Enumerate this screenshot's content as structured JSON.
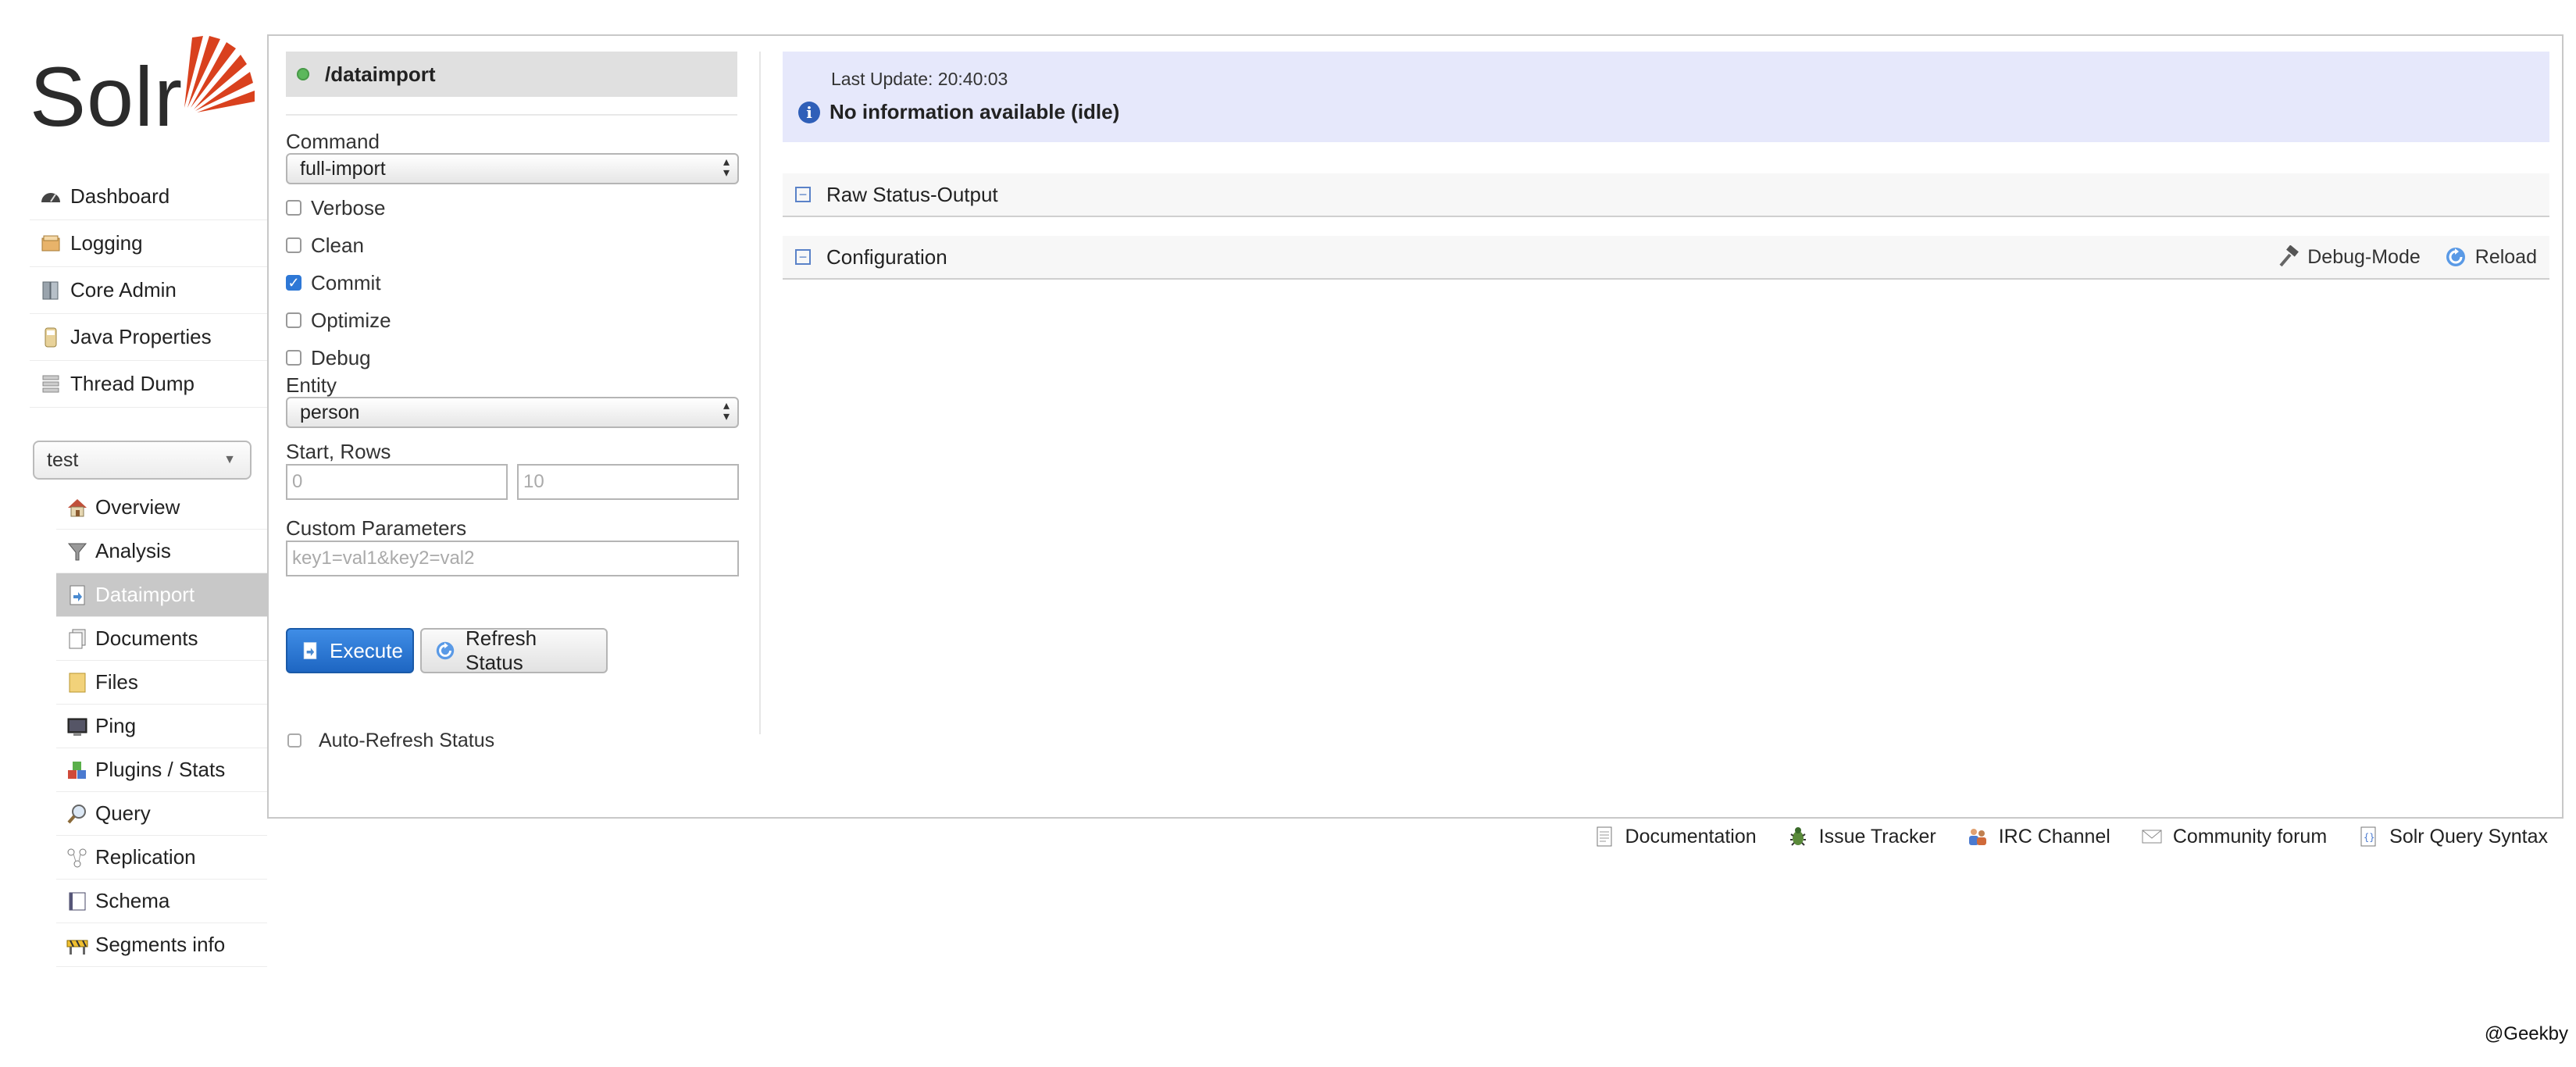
{
  "logo": {
    "text": "Solr"
  },
  "main_menu": [
    {
      "label": "Dashboard",
      "icon": "dashboard-icon"
    },
    {
      "label": "Logging",
      "icon": "logging-icon"
    },
    {
      "label": "Core Admin",
      "icon": "core-admin-icon"
    },
    {
      "label": "Java Properties",
      "icon": "java-properties-icon"
    },
    {
      "label": "Thread Dump",
      "icon": "thread-dump-icon"
    }
  ],
  "core_selector": {
    "value": "test"
  },
  "core_menu": [
    {
      "label": "Overview",
      "icon": "home-icon"
    },
    {
      "label": "Analysis",
      "icon": "funnel-icon"
    },
    {
      "label": "Dataimport",
      "icon": "dataimport-icon",
      "active": true
    },
    {
      "label": "Documents",
      "icon": "documents-icon"
    },
    {
      "label": "Files",
      "icon": "folder-icon"
    },
    {
      "label": "Ping",
      "icon": "terminal-icon"
    },
    {
      "label": "Plugins / Stats",
      "icon": "plugins-icon"
    },
    {
      "label": "Query",
      "icon": "magnifier-icon"
    },
    {
      "label": "Replication",
      "icon": "replication-icon"
    },
    {
      "label": "Schema",
      "icon": "book-icon"
    },
    {
      "label": "Segments info",
      "icon": "segments-icon"
    }
  ],
  "dataimport": {
    "handler": "/dataimport",
    "command_label": "Command",
    "command_value": "full-import",
    "options": [
      {
        "label": "Verbose",
        "checked": false
      },
      {
        "label": "Clean",
        "checked": false
      },
      {
        "label": "Commit",
        "checked": true
      },
      {
        "label": "Optimize",
        "checked": false
      },
      {
        "label": "Debug",
        "checked": false
      }
    ],
    "entity_label": "Entity",
    "entity_value": "person",
    "start_rows_label": "Start, Rows",
    "start_placeholder": "0",
    "rows_placeholder": "10",
    "custom_params_label": "Custom Parameters",
    "custom_params_placeholder": "key1=val1&key2=val2",
    "execute_label": "Execute",
    "refresh_label": "Refresh Status",
    "auto_refresh_label": "Auto-Refresh Status"
  },
  "status": {
    "last_update": "Last Update: 20:40:03",
    "message": "No information available (idle)"
  },
  "sections": {
    "raw_status": "Raw Status-Output",
    "configuration": "Configuration",
    "debug_mode": "Debug-Mode",
    "reload": "Reload"
  },
  "footer": [
    {
      "label": "Documentation",
      "icon": "document-icon"
    },
    {
      "label": "Issue Tracker",
      "icon": "bug-icon"
    },
    {
      "label": "IRC Channel",
      "icon": "irc-icon"
    },
    {
      "label": "Community forum",
      "icon": "envelope-icon"
    },
    {
      "label": "Solr Query Syntax",
      "icon": "query-syntax-icon"
    }
  ],
  "credit": "@Geekby",
  "colors": {
    "accent": "#2e78d6",
    "status_bg": "#e6e8fb",
    "active_nav": "#c8c8c8",
    "logo_red": "#d9411e"
  }
}
